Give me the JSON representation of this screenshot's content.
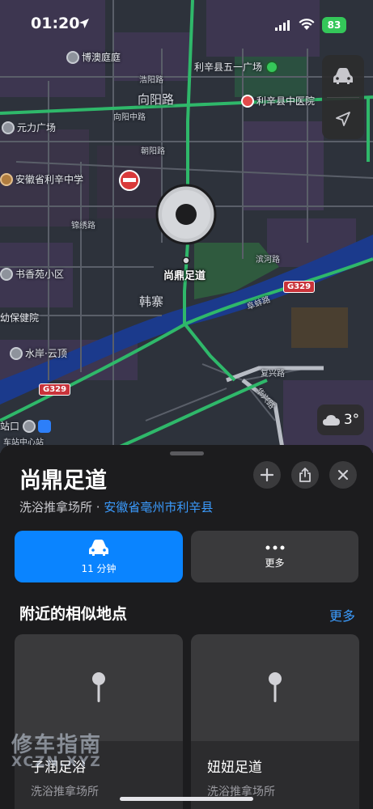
{
  "status_bar": {
    "time": "01:20",
    "battery": "83"
  },
  "map": {
    "labels": {
      "bozhou_ting": "博澳庭庭",
      "wuyi_square": "利辛县五一广场",
      "xiangyang_road": "向阳路",
      "zhongyiyuan": "利辛县中医院",
      "yuanli_square": "元力广场",
      "xiangyang_zhong_road": "向阳中路",
      "lixin_middle_school": "安徽省利辛中学",
      "shuxiangyuan": "书香苑小区",
      "hanzhai": "韩寨",
      "fuyou_hospital": "幼保健院",
      "shuian_yunding": "水岸·云顶",
      "fuxing_road": "复兴路",
      "huaxing_road": "华兴路",
      "fuzhong_road": "阜蚌路",
      "station": "站口",
      "bus_center": "车站中心站",
      "jiefang_road": "浩阳路",
      "chaoyang_road": "朝阳路",
      "jinqiao_road": "锦绣路",
      "binhe_road": "滨河路",
      "pin_label": "尚鼎足道"
    },
    "shields": {
      "g329_a": "G329",
      "g329_b": "G329"
    },
    "weather": {
      "temp": "3°",
      "icon": "cloud-icon"
    }
  },
  "sheet": {
    "title": "尚鼎足道",
    "category": "洗浴推拿场所 · ",
    "location": "安徽省亳州市利辛县",
    "actions": {
      "drive_time": "11 分钟",
      "more": "更多"
    },
    "nearby_title": "附近的相似地点",
    "nearby_more": "更多",
    "cards": [
      {
        "name": "子润足浴",
        "category": "洗浴推拿场所"
      },
      {
        "name": "妞妞足道",
        "category": "洗浴推拿场所"
      }
    ]
  },
  "watermark": {
    "line1": "修车指南",
    "line2": "XCZN.XYZ"
  }
}
